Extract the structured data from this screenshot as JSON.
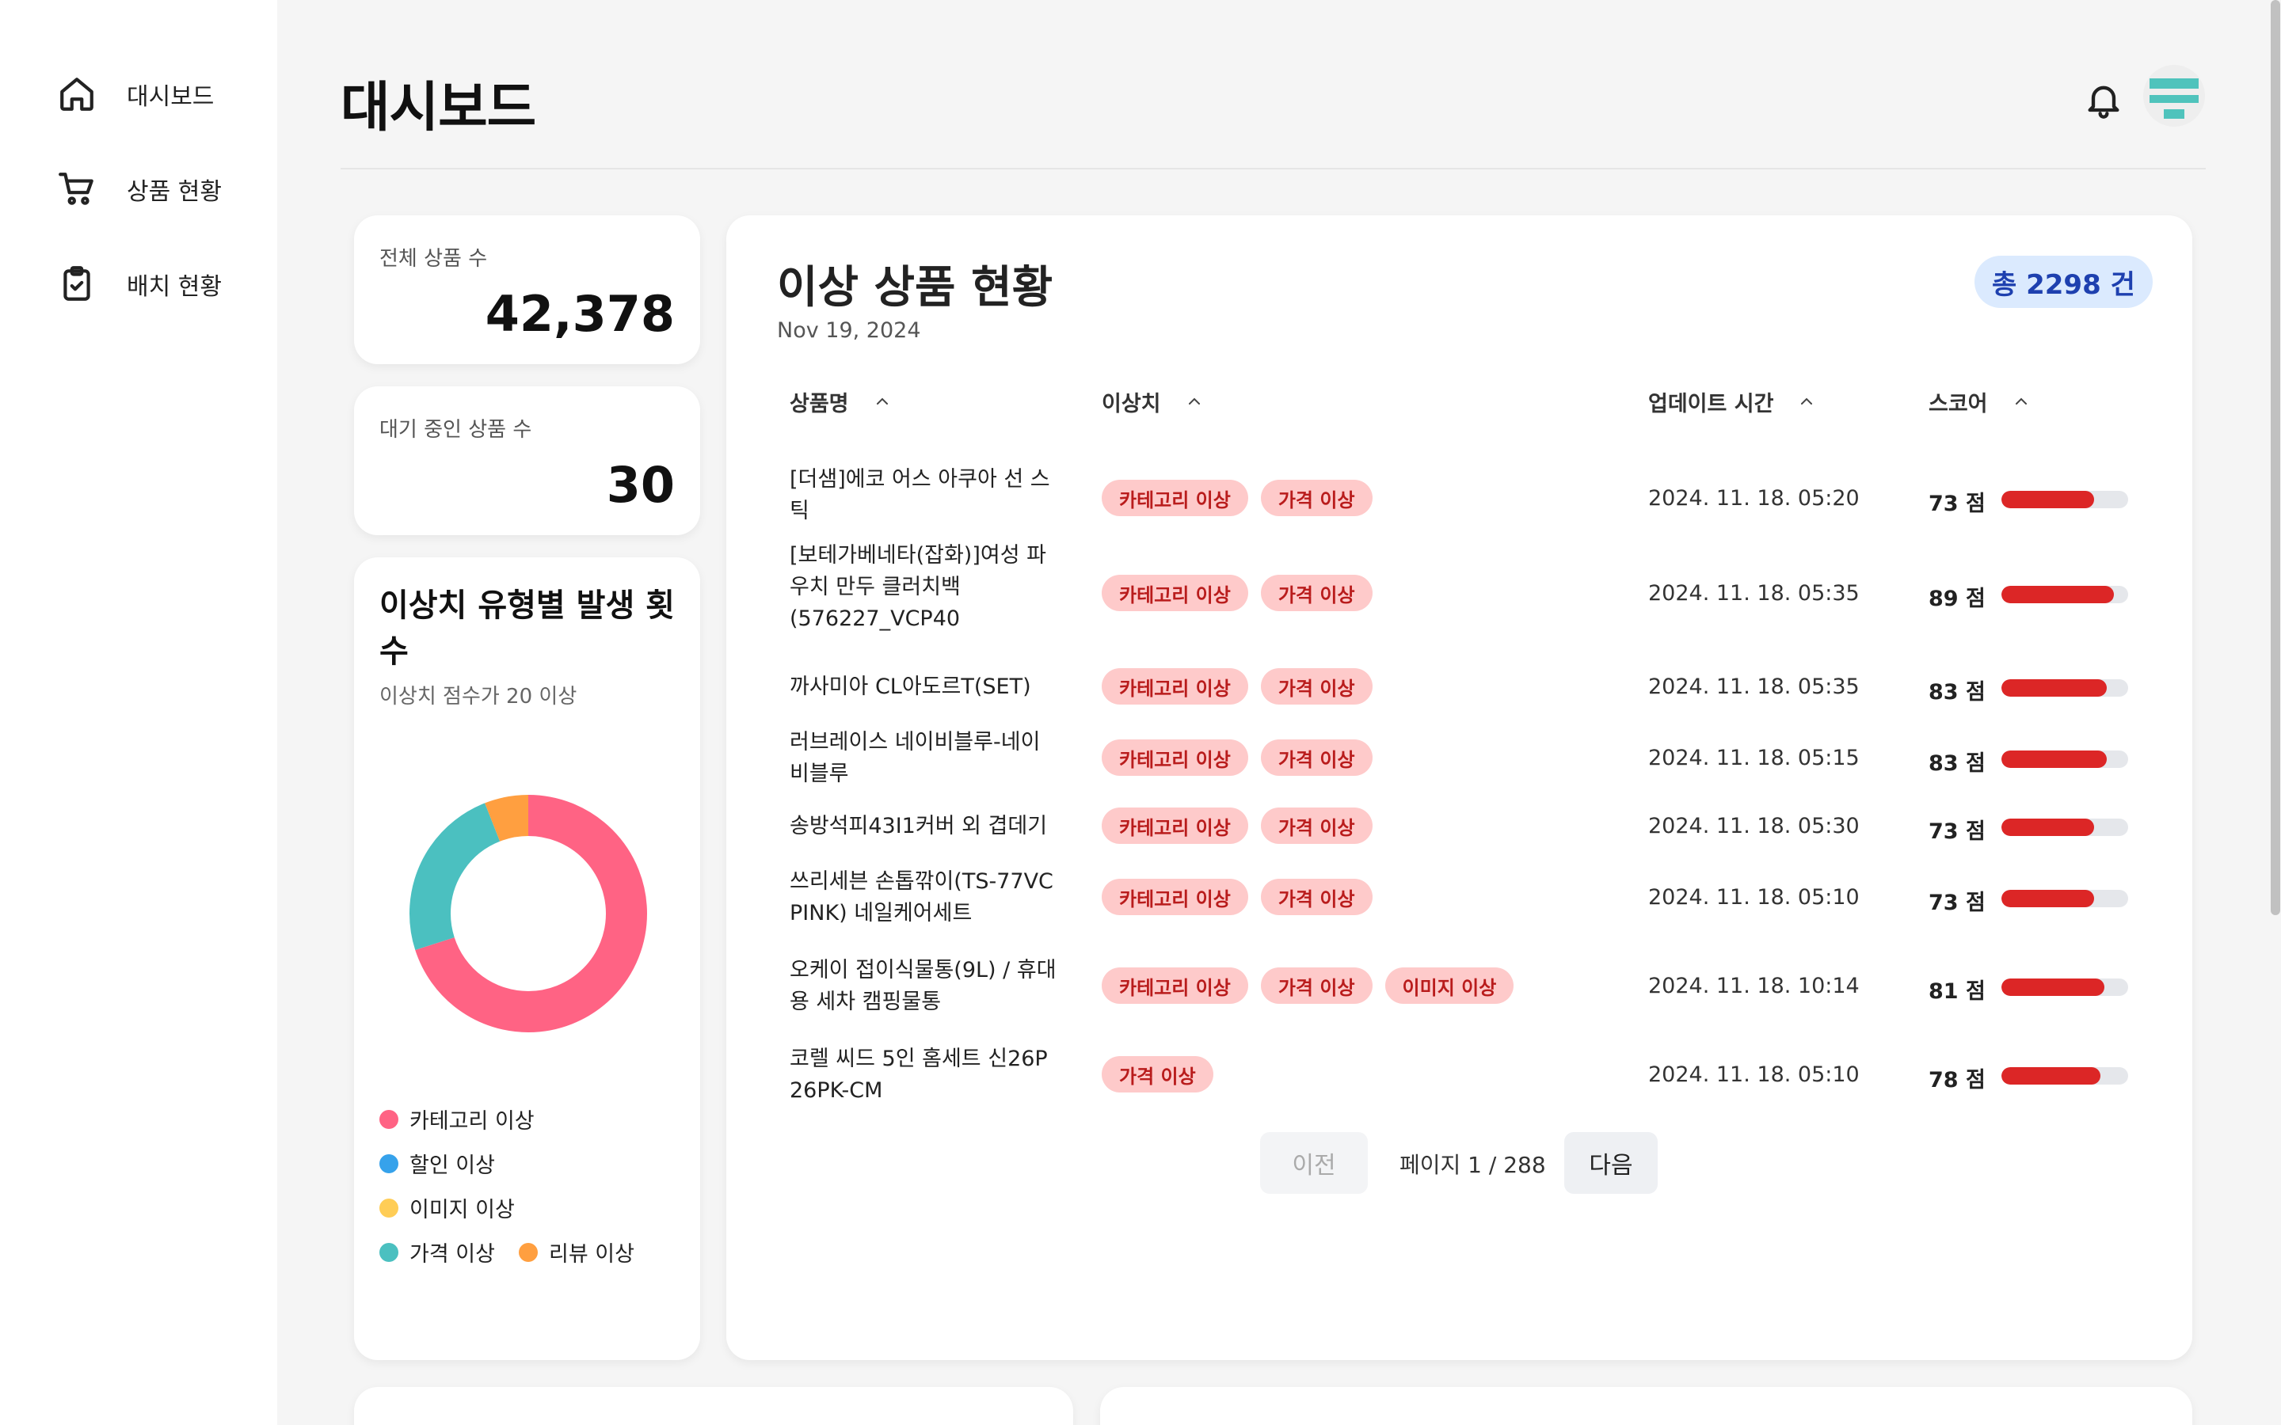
{
  "sidebar": {
    "items": [
      {
        "label": "대시보드",
        "icon": "home-icon"
      },
      {
        "label": "상품 현황",
        "icon": "cart-icon"
      },
      {
        "label": "배치 현황",
        "icon": "clipboard-check-icon"
      }
    ]
  },
  "header": {
    "title": "대시보드",
    "icons": [
      "bell-icon",
      "avatar"
    ]
  },
  "stats": {
    "total": {
      "label": "전체 상품 수",
      "value": "42,378"
    },
    "pending": {
      "label": "대기 중인 상품 수",
      "value": "30"
    }
  },
  "chart_card": {
    "title": "이상치 유형별 발생 횟수",
    "subtitle": "이상치 점수가 20 이상"
  },
  "chart_data": {
    "type": "pie",
    "series": [
      {
        "name": "카테고리 이상",
        "value": 70,
        "color": "#ff6384"
      },
      {
        "name": "할인 이상",
        "value": 0,
        "color": "#36a2eb"
      },
      {
        "name": "이미지 이상",
        "value": 0,
        "color": "#ffcd56"
      },
      {
        "name": "가격 이상",
        "value": 24,
        "color": "#4bc0c0"
      },
      {
        "name": "리뷰 이상",
        "value": 6,
        "color": "#ff9f40"
      }
    ],
    "legend": [
      "카테고리 이상",
      "할인 이상",
      "이미지 이상",
      "가격 이상",
      "리뷰 이상"
    ]
  },
  "anomaly_table": {
    "title": "이상 상품 현황",
    "date": "Nov 19, 2024",
    "total_badge": "총 2298 건",
    "columns": [
      "상품명",
      "이상치",
      "업데이트 시간",
      "스코어"
    ],
    "rows": [
      {
        "name": "[더샘]에코 어스 아쿠아 선 스틱",
        "tags": [
          "카테고리 이상",
          "가격 이상"
        ],
        "time": "2024. 11. 18. 05:20",
        "score": "73 점",
        "score_value": 73
      },
      {
        "name": "[보테가베네타(잡화)]여성 파우치 만두 클러치백 (576227_VCP40",
        "tags": [
          "카테고리 이상",
          "가격 이상"
        ],
        "time": "2024. 11. 18. 05:35",
        "score": "89 점",
        "score_value": 89
      },
      {
        "name": "까사미아 CL아도르T(SET)",
        "tags": [
          "카테고리 이상",
          "가격 이상"
        ],
        "time": "2024. 11. 18. 05:35",
        "score": "83 점",
        "score_value": 83
      },
      {
        "name": "러브레이스 네이비블루-네이비블루",
        "tags": [
          "카테고리 이상",
          "가격 이상"
        ],
        "time": "2024. 11. 18. 05:15",
        "score": "83 점",
        "score_value": 83
      },
      {
        "name": "송방석피43I1커버 외 겹데기",
        "tags": [
          "카테고리 이상",
          "가격 이상"
        ],
        "time": "2024. 11. 18. 05:30",
        "score": "73 점",
        "score_value": 73
      },
      {
        "name": "쓰리세븐 손톱깎이(TS-77VC PINK) 네일케어세트",
        "tags": [
          "카테고리 이상",
          "가격 이상"
        ],
        "time": "2024. 11. 18. 05:10",
        "score": "73 점",
        "score_value": 73
      },
      {
        "name": "오케이 접이식물통(9L) / 휴대용 세차 캠핑물통",
        "tags": [
          "카테고리 이상",
          "가격 이상",
          "이미지 이상"
        ],
        "time": "2024. 11. 18. 10:14",
        "score": "81 점",
        "score_value": 81
      },
      {
        "name": "코렐 씨드 5인 홈세트 신26P 26PK-CM",
        "tags": [
          "가격 이상"
        ],
        "time": "2024. 11. 18. 05:10",
        "score": "78 점",
        "score_value": 78
      }
    ],
    "pagination": {
      "prev": "이전",
      "info": "페이지 1 / 288",
      "next": "다음"
    }
  }
}
